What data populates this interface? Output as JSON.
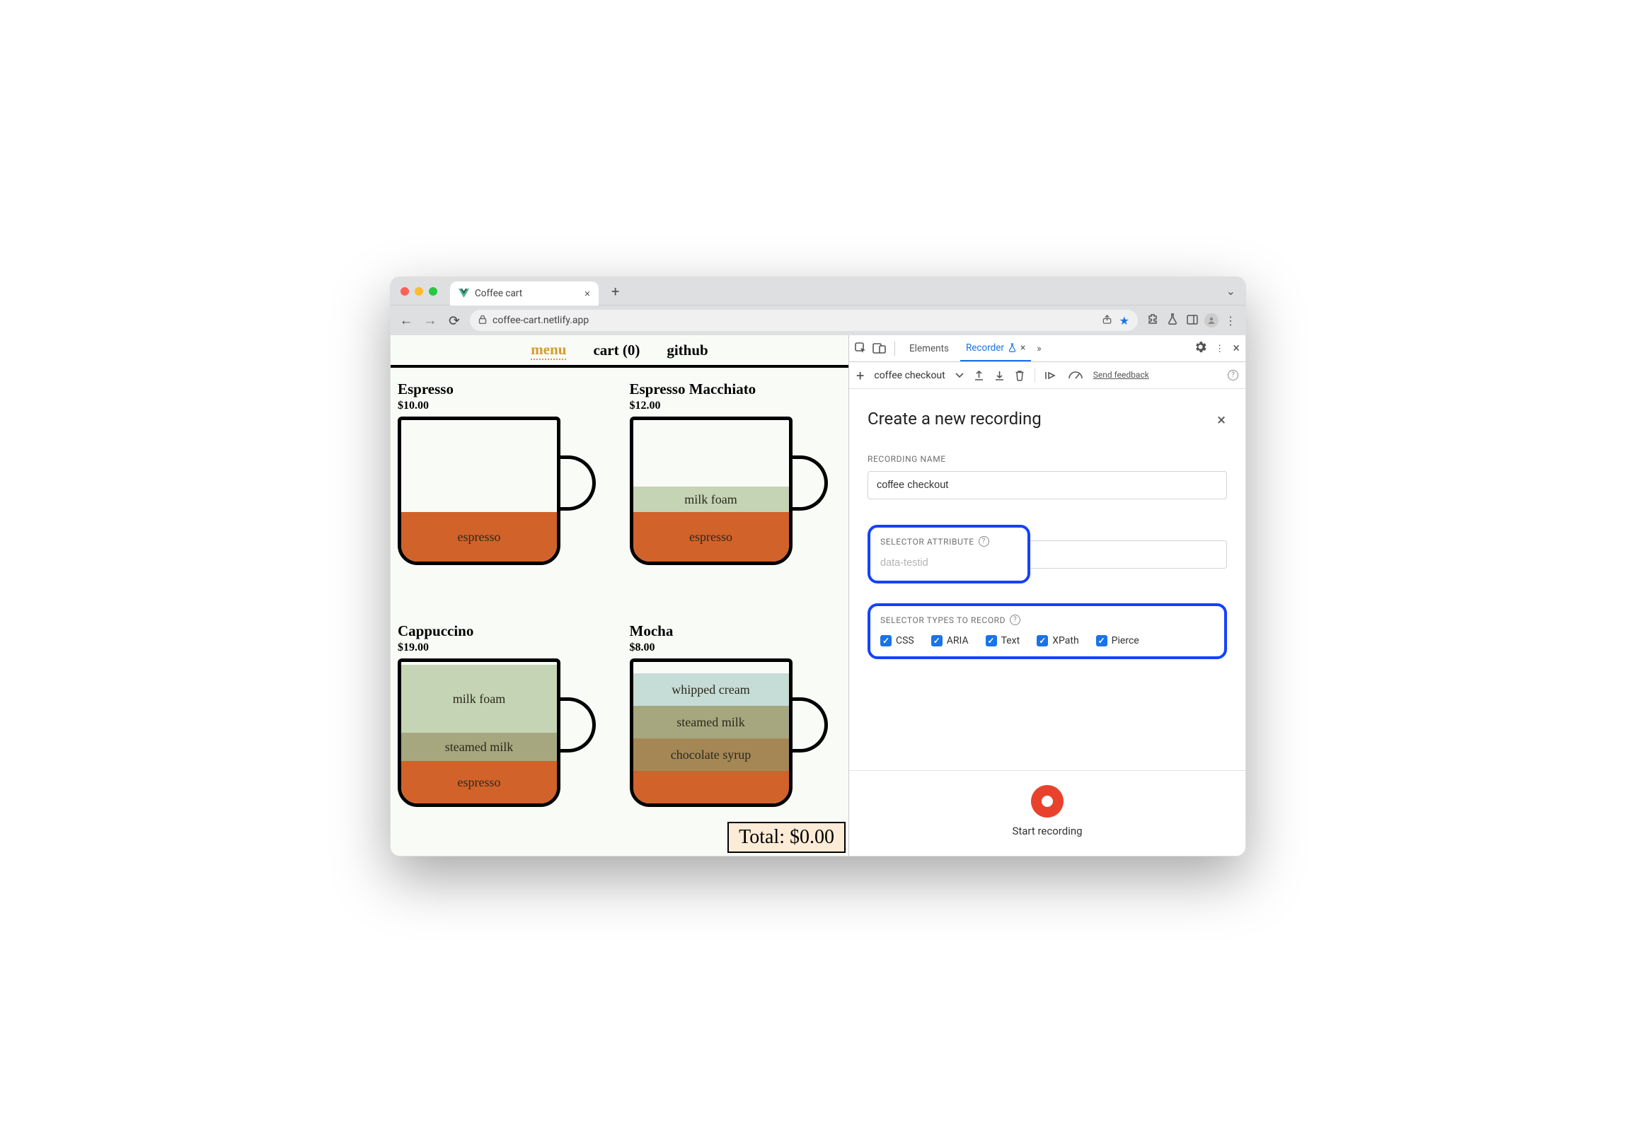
{
  "browser": {
    "tab_title": "Coffee cart",
    "url": "coffee-cart.netlify.app"
  },
  "page": {
    "nav": {
      "menu": "menu",
      "cart": "cart (0)",
      "github": "github"
    },
    "products": [
      {
        "id": "espresso",
        "name": "Espresso",
        "price": "$10.00",
        "layers": [
          {
            "label": "espresso",
            "class": "espresso-l",
            "height": 70
          }
        ]
      },
      {
        "id": "espresso-macchiato",
        "name": "Espresso Macchiato",
        "price": "$12.00",
        "layers": [
          {
            "label": "milk foam",
            "class": "milkfoam-l",
            "height": 36
          },
          {
            "label": "espresso",
            "class": "espresso-l",
            "height": 70
          }
        ]
      },
      {
        "id": "cappuccino",
        "name": "Cappuccino",
        "price": "$19.00",
        "layers": [
          {
            "label": "milk foam",
            "class": "milkfoam-l",
            "height": 96
          },
          {
            "label": "steamed milk",
            "class": "steamed-l",
            "height": 40
          },
          {
            "label": "espresso",
            "class": "espresso-l",
            "height": 60
          }
        ]
      },
      {
        "id": "mocha",
        "name": "Mocha",
        "price": "$8.00",
        "layers": [
          {
            "label": "whipped cream",
            "class": "whipped-l",
            "height": 46
          },
          {
            "label": "steamed milk",
            "class": "steamed-l",
            "height": 46
          },
          {
            "label": "chocolate syrup",
            "class": "choco-l",
            "height": 46
          },
          {
            "label": "",
            "class": "espresso-l",
            "height": 46
          }
        ]
      }
    ],
    "total_label": "Total: $0.00"
  },
  "devtools": {
    "tabs": {
      "elements": "Elements",
      "recorder": "Recorder"
    },
    "toolbar": {
      "flow_name": "coffee checkout",
      "feedback": "Send feedback"
    },
    "panel": {
      "title": "Create a new recording",
      "recording_name_label": "RECORDING NAME",
      "recording_name_value": "coffee checkout",
      "selector_attr_label": "SELECTOR ATTRIBUTE",
      "selector_attr_placeholder": "data-testid",
      "selector_types_label": "SELECTOR TYPES TO RECORD",
      "selector_types": {
        "css": "CSS",
        "aria": "ARIA",
        "text": "Text",
        "xpath": "XPath",
        "pierce": "Pierce"
      },
      "start_button": "Start recording"
    }
  }
}
